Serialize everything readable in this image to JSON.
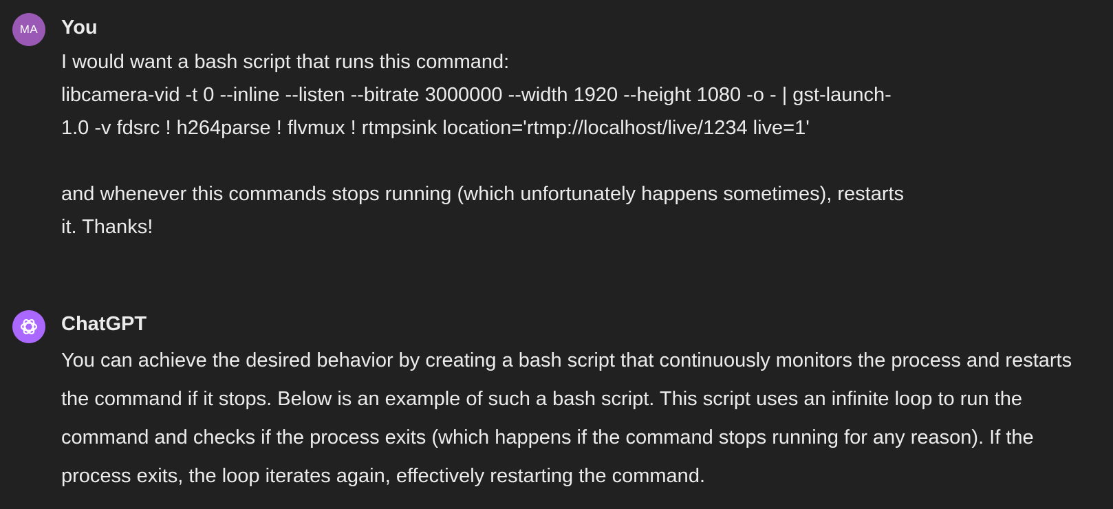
{
  "user_message": {
    "avatar_initials": "MA",
    "author": "You",
    "lines": [
      "I would want a bash script that runs this command:",
      "libcamera-vid -t 0 --inline --listen --bitrate 3000000 --width 1920 --height 1080 -o - | gst-launch-",
      "1.0 -v fdsrc ! h264parse ! flvmux ! rtmpsink location='rtmp://localhost/live/1234 live=1'",
      "and whenever this commands stops running (which unfortunately happens sometimes), restarts",
      "it. Thanks!"
    ]
  },
  "assistant_message": {
    "avatar_icon": "openai-logo-icon",
    "author": "ChatGPT",
    "text": "You can achieve the desired behavior by creating a bash script that continuously monitors the process and restarts the command if it stops. Below is an example of such a bash script. This script uses an infinite loop to run the command and checks if the process exits (which happens if the command stops running for any reason). If the process exits, the loop iterates again, effectively restarting the command."
  },
  "colors": {
    "background": "#212121",
    "text": "#ececec",
    "user_avatar": "#9b59b6",
    "assistant_avatar": "#ab68ff"
  }
}
